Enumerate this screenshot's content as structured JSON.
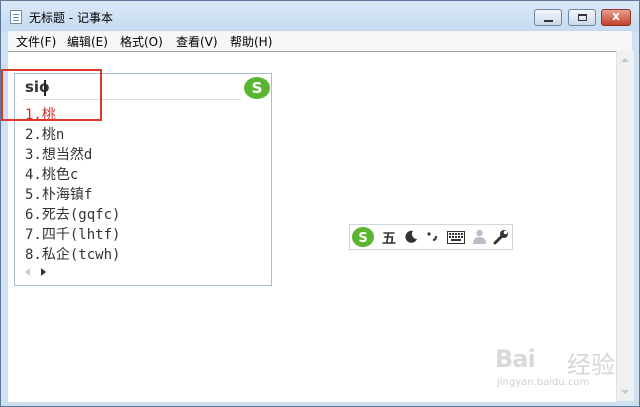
{
  "window": {
    "title": "无标题 - 记事本",
    "controls": {
      "close_glyph": "x"
    }
  },
  "menu": {
    "items": [
      {
        "label": "文件(F)"
      },
      {
        "label": "编辑(E)"
      },
      {
        "label": "格式(O)"
      },
      {
        "label": "查看(V)"
      },
      {
        "label": "帮助(H)"
      }
    ]
  },
  "ime": {
    "input_text": "sio",
    "candidates": [
      "1.桃",
      "2.桃n",
      "3.想当然d",
      "4.桃色c",
      "5.朴海镇f",
      "6.死去(gqfc)",
      "7.四千(lhtf)",
      "8.私企(tcwh)"
    ],
    "selected_index": 0,
    "logo_icon": "sogou-s-icon",
    "status_bar": {
      "mode_label": "五",
      "icons": [
        "moon-icon",
        "punctuation-icon",
        "keyboard-icon",
        "user-icon",
        "wrench-icon"
      ]
    }
  },
  "colors": {
    "highlight": "#e0372d",
    "sogou_green": "#5bb531",
    "selected_candidate": "#d0302c"
  },
  "watermark": {
    "brand": "Bai",
    "jingyan": "经验",
    "url": "jingyan.baidu.com"
  }
}
